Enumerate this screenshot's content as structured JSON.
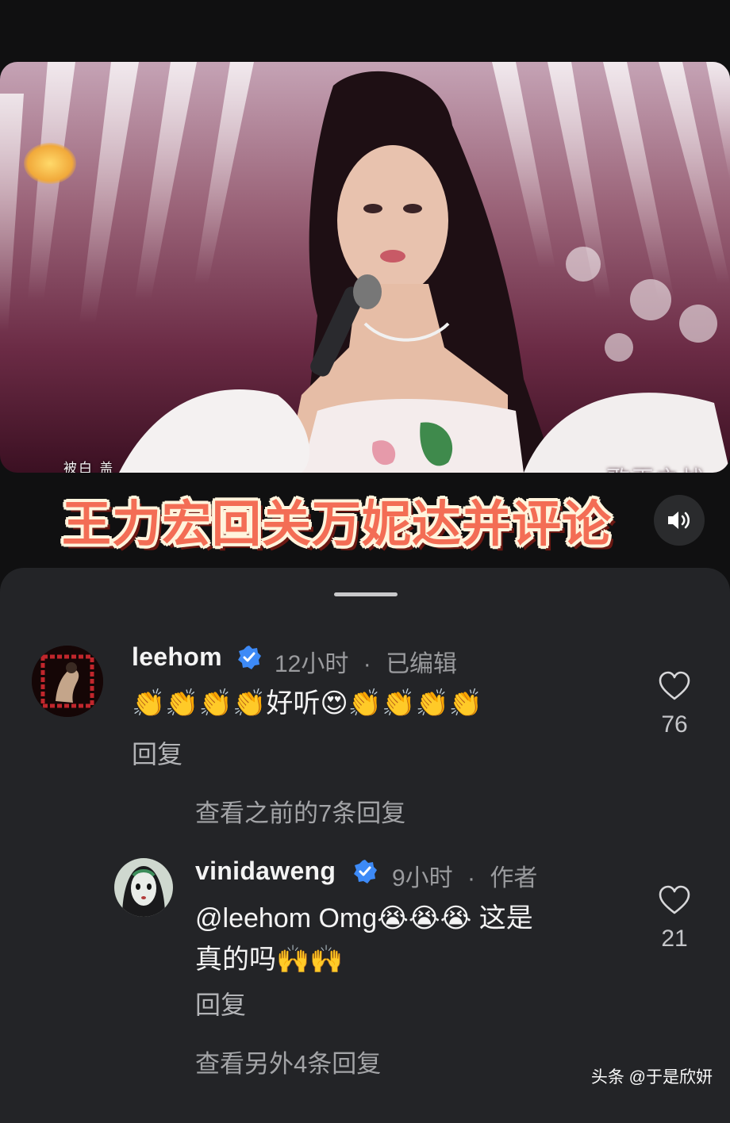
{
  "video": {
    "subtitle_lines": "被白 盖\n那 翠",
    "watermark": "歌王之战"
  },
  "caption": "王力宏回关万妮达并评论",
  "sound_icon": "speaker-icon",
  "comments": [
    {
      "username": "leehom",
      "verified": true,
      "time": "12小时",
      "meta_suffix": "已编辑",
      "text_line1": "👏👏👏👏好听😍👏👏👏👏",
      "reply_label": "回复",
      "likes": "76",
      "more_replies": "查看之前的7条回复"
    },
    {
      "username": "vinidaweng",
      "verified": true,
      "time": "9小时",
      "meta_suffix": "作者",
      "text_line1": "@leehom Omg😭😭😭 这是",
      "text_line2": "真的吗🙌🙌",
      "reply_label": "回复",
      "likes": "21",
      "more_replies": "查看另外4条回复"
    }
  ],
  "separator": "·",
  "footer_watermark": "头条 @于是欣妍",
  "colors": {
    "background": "#101011",
    "sheet": "#232427",
    "verified_blue": "#3d8af7",
    "caption_orange": "#f36d55"
  }
}
